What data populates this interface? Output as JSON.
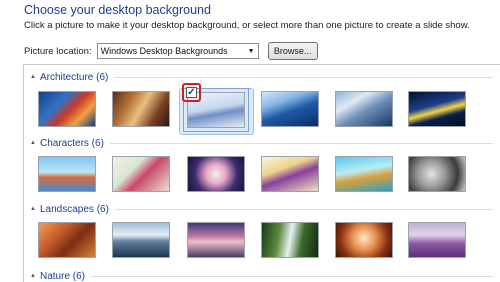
{
  "header": {
    "title": "Choose your desktop background",
    "subtitle": "Click a picture to make it your desktop background, or select more than one picture to create a slide show."
  },
  "location": {
    "label": "Picture location:",
    "selected": "Windows Desktop Backgrounds",
    "browse_label": "Browse..."
  },
  "groups": [
    {
      "title": "Architecture (6)"
    },
    {
      "title": "Characters (6)"
    },
    {
      "title": "Landscapes (6)"
    },
    {
      "title": "Nature (6)"
    }
  ],
  "selection": {
    "checked_mark": "✓",
    "selected_group": "Architecture",
    "selected_index": 3
  },
  "colors": {
    "title": "#1e3f8a",
    "highlight": "#dbe9f8",
    "callout": "#d21f1f"
  }
}
